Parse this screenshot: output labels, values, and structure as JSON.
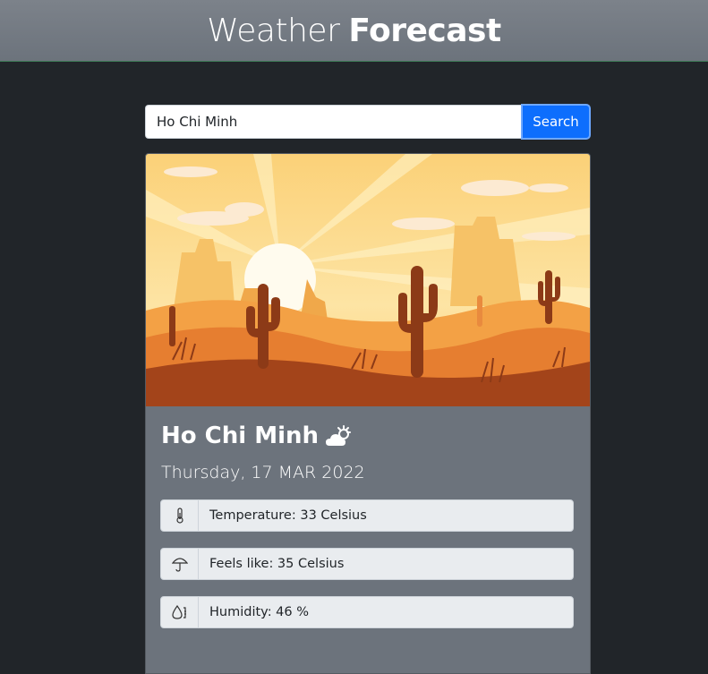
{
  "header": {
    "title_light": "Weather",
    "title_bold": "Forecast"
  },
  "search": {
    "value": "Ho Chi Minh",
    "button_label": "Search"
  },
  "weather": {
    "city": "Ho Chi Minh",
    "condition_icon": "partly-sunny-icon",
    "date": "Thursday, 17 MAR 2022",
    "rows": [
      {
        "icon": "thermometer-icon",
        "text": "Temperature: 33 Celsius"
      },
      {
        "icon": "umbrella-icon",
        "text": "Feels like: 35 Celsius"
      },
      {
        "icon": "droplet-icon",
        "text": "Humidity: 46 %"
      }
    ]
  },
  "colors": {
    "background": "#212529",
    "header": "#6c737c",
    "card": "#6c737c",
    "accent": "#0d6efd"
  }
}
